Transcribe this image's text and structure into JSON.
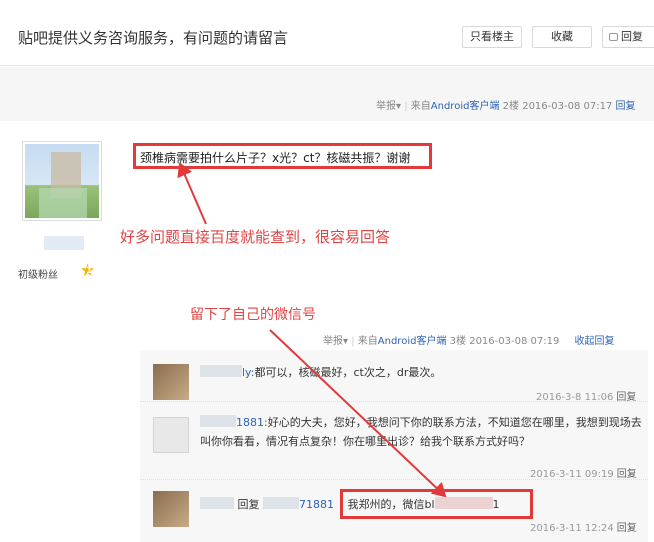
{
  "thread": {
    "title": "贴吧提供义务咨询服务，有问题的请留言",
    "buttons": {
      "only_op": "只看楼主",
      "favorite": "收藏",
      "reply": "回复"
    }
  },
  "post1": {
    "report": "举报",
    "source_prefix": "来自",
    "source_link": "Android客户端",
    "floor": "2楼",
    "time": "2016-03-08 07:17",
    "reply_link": "回复"
  },
  "post2": {
    "question": "颈椎病需要拍什么片子？x光？ct？核磁共振？谢谢",
    "user_rank": "初级粉丝",
    "level": "1",
    "report": "举报",
    "source_prefix": "来自",
    "source_link": "Android客户端",
    "floor": "3楼",
    "time": "2016-03-08 07:19",
    "collapse_reply": "收起回复"
  },
  "annotations": {
    "first": "好多问题直接百度就能查到，很容易回答",
    "second": "留下了自己的微信号"
  },
  "replies": [
    {
      "user_suffix": "ly:",
      "content": "都可以，核磁最好，ct次之，dr最次。",
      "time": "2016-3-8 11:06",
      "reply": "回复"
    },
    {
      "user_suffix": "1881:",
      "content": "好心的大夫，您好，我想问下你的联系方法，不知道您在哪里，我想到现场去叫你你看看，情况有点复杂！你在哪里出诊？给我个联系方式好吗？",
      "time": "2016-3-11 09:19",
      "reply": "回复"
    },
    {
      "reply_prefix": "回复",
      "target_suffix": "71881",
      "content_prefix": "我郑州的，微信bl",
      "content_suffix": "1",
      "time": "2016-3-11 12:24",
      "reply": "回复"
    }
  ],
  "colors": {
    "annotation_red": "#e23a3a",
    "link_blue": "#2d64b3"
  },
  "icons": {
    "report_caret": "caret-down-icon",
    "reply_icon": "speech-bubble-icon",
    "level_badge": "star-icon"
  }
}
